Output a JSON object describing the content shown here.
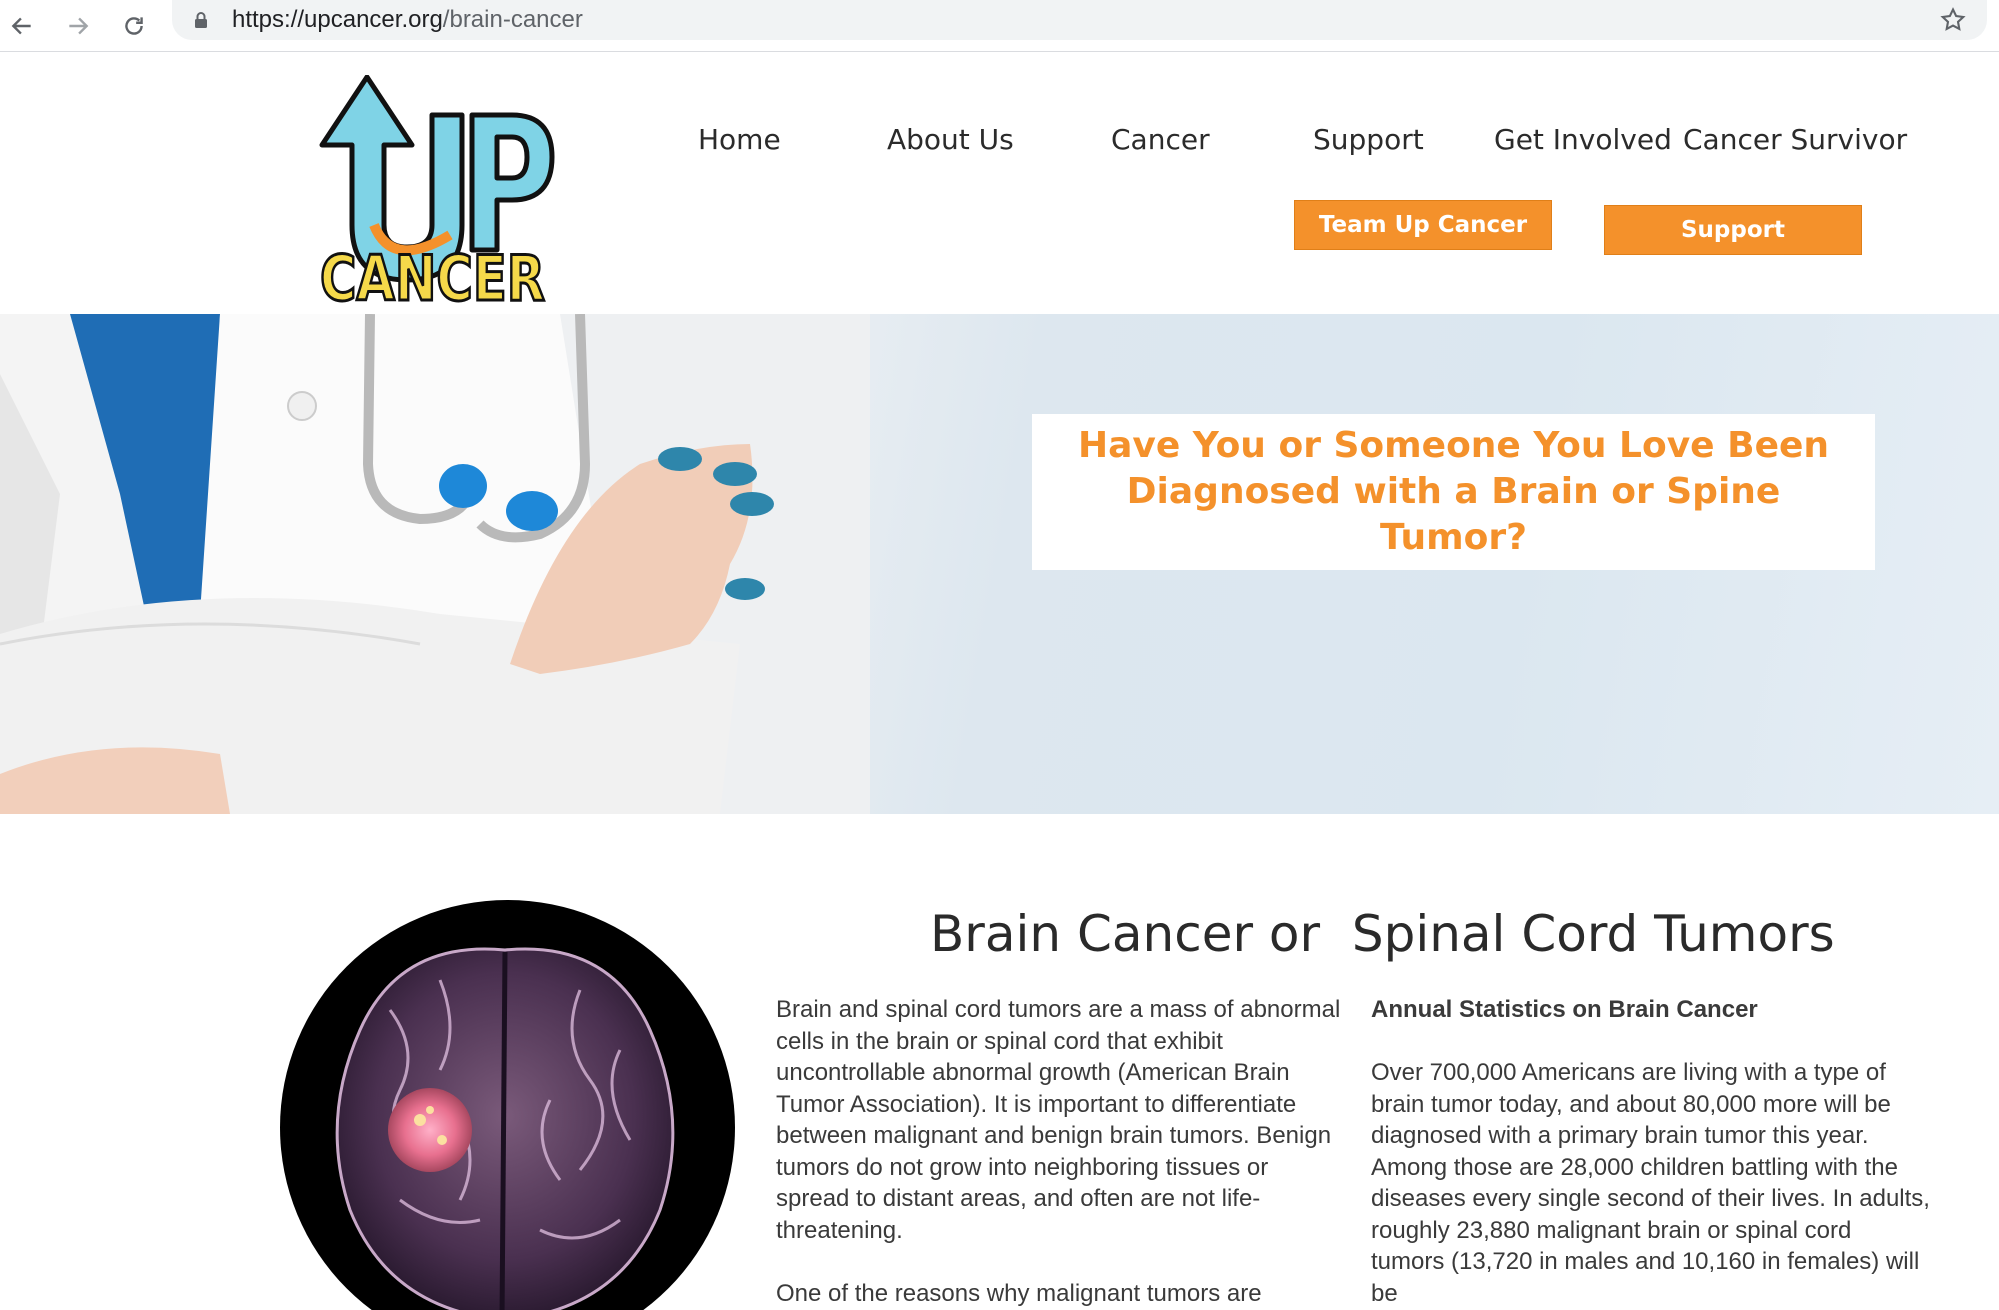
{
  "browser": {
    "url_host": "https://upcancer.org",
    "url_path": "/brain-cancer"
  },
  "header": {
    "logo_text_top": "UP",
    "logo_text_bottom": "CANCER",
    "menu": [
      "Home",
      "About Us",
      "Cancer",
      "Support",
      "Get Involved",
      "Cancer Survivor"
    ],
    "cta_team": "Team Up Cancer",
    "cta_support": "Support"
  },
  "hero": {
    "title": "Have You or Someone You Love Been Diagnosed with a Brain or Spine Tumor?"
  },
  "content": {
    "title": "Brain Cancer or  Spinal Cord Tumors",
    "col1_p1": "Brain and spinal cord tumors are a mass of abnormal cells in the brain or spinal cord that exhibit uncontrollable abnormal growth (American Brain Tumor Association). It is important to differentiate between malignant and benign brain tumors. Benign tumors do not grow into neighboring tissues or spread to distant areas, and often are not life-threatening.",
    "col1_p2": "One of the reasons why malignant tumors are",
    "col2_heading": "Annual Statistics on Brain Cancer",
    "col2_p1": "Over 700,000 Americans are living with a type of brain tumor today, and about 80,000 more will be diagnosed with a primary brain tumor this year. Among those are 28,000 children battling with the diseases every single second of their lives. In adults, roughly 23,880 malignant brain or spinal cord tumors (13,720 in males and 10,160 in females) will be"
  },
  "colors": {
    "accent": "#f4912b",
    "logo_blue": "#7fd3e6",
    "logo_yellow": "#f5d94a"
  }
}
